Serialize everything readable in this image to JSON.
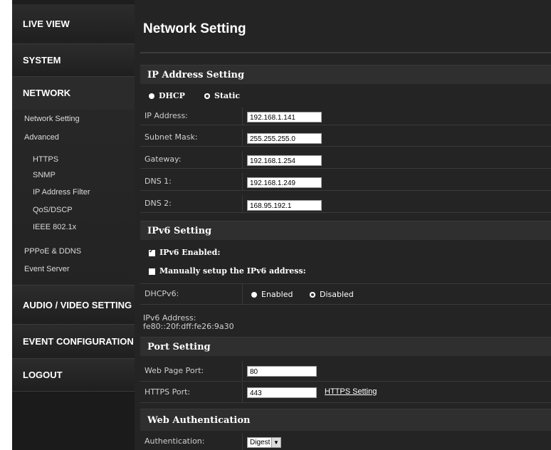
{
  "sidebar": {
    "live_view": "LIVE VIEW",
    "system": "SYSTEM",
    "network": "NETWORK",
    "network_sub": {
      "network_setting": "Network Setting",
      "advanced": "Advanced",
      "https": "HTTPS",
      "snmp": "SNMP",
      "ip_filter": "IP Address Filter",
      "qos": "QoS/DSCP",
      "ieee": "IEEE 802.1x",
      "pppoe": "PPPoE & DDNS",
      "event_server": "Event Server"
    },
    "audio_video": "AUDIO / VIDEO SETTING",
    "event_config": "EVENT CONFIGURATION",
    "logout": "LOGOUT"
  },
  "main": {
    "title": "Network Setting",
    "ip_section": {
      "header": "IP Address Setting",
      "dhcp_label": "DHCP",
      "static_label": "Static",
      "selected_mode": "DHCP",
      "ip_address_label": "IP Address:",
      "ip_address_value": "192.168.1.141",
      "subnet_label": "Subnet Mask:",
      "subnet_value": "255.255.255.0",
      "gateway_label": "Gateway:",
      "gateway_value": "192.168.1.254",
      "dns1_label": "DNS 1:",
      "dns1_value": "192.168.1.249",
      "dns2_label": "DNS 2:",
      "dns2_value": "168.95.192.1"
    },
    "ipv6_section": {
      "header": "IPv6 Setting",
      "enabled_label": "IPv6 Enabled:",
      "enabled_checked": true,
      "manual_label": "Manually setup the IPv6 address:",
      "manual_checked": false,
      "dhcpv6_label": "DHCPv6:",
      "dhcpv6_enabled": "Enabled",
      "dhcpv6_disabled": "Disabled",
      "dhcpv6_selected": "Disabled",
      "address_label": "IPv6 Address:",
      "address_value": "fe80::20f:dff:fe26:9a30"
    },
    "port_section": {
      "header": "Port Setting",
      "web_port_label": "Web Page Port:",
      "web_port_value": "80",
      "https_port_label": "HTTPS Port:",
      "https_port_value": "443",
      "https_link": "HTTPS Setting"
    },
    "auth_section": {
      "header": "Web Authentication",
      "auth_label": "Authentication:",
      "auth_value": "Digest"
    }
  },
  "colors": {
    "background": "#242424",
    "sidebar": "#1e1e1e",
    "text": "#ffffff"
  }
}
